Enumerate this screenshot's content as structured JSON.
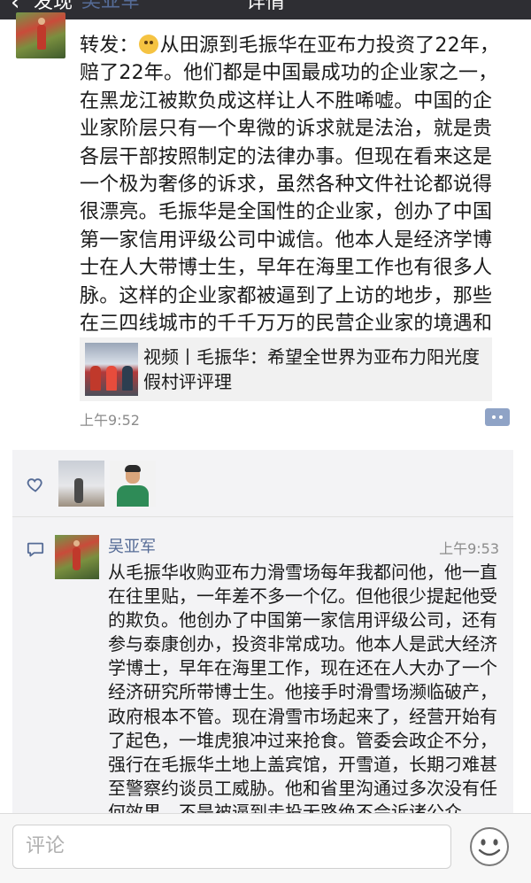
{
  "nav": {
    "back_label": "发现",
    "title": "详情"
  },
  "post": {
    "author": "吴亚军",
    "text_prefix": "转发：",
    "text": "从田源到毛振华在亚布力投资了22年，赔了22年。他们都是中国最成功的企业家之一，在黑龙江被欺负成这样让人不胜唏嘘。中国的企业家阶层只有一个卑微的诉求就是法治，就是贵各层干部按照制定的法律办事。但现在看来这是一个极为奢侈的诉求，虽然各种文件社论都说得很漂亮。毛振华是全国性的企业家，创办了中国第一家信用评级公司中诚信。他本人是经济学博士在人大带博士生，早年在海里工作也有很多人脉。这样的企业家都被逼到了上访的地步，那些在三四线城市的千千万万的民营企业家的境遇和辛酸可见一斑。",
    "share_title": "视频丨毛振华：希望全世界为亚布力阳光度假村评评理",
    "time": "上午9:52"
  },
  "comment": {
    "author": "吴亚军",
    "time": "上午9:53",
    "text": "从毛振华收购亚布力滑雪场每年我都问他，他一直在往里贴，一年差不多一个亿。但他很少提起他受的欺负。他创办了中国第一家信用评级公司，还有参与泰康创办，投资非常成功。他本人是武大经济学博士，早年在海里工作，现在还在人大办了一个经济研究所带博士生。他接手时滑雪场濒临破产，政府根本不管。现在滑雪市场起来了，经营开始有了起色，一堆虎狼冲过来抢食。管委会政企不分，强行在毛振华土地上盖宾馆，开雪道，长期刁难甚至警察约谈员工威胁。他和省里沟通过多次没有任何效果。不是被逼到走投无路绝不会诉诸公众"
  },
  "input": {
    "placeholder": "评论"
  },
  "icons": {
    "like": "heart-outline-icon",
    "comment": "comment-bubble-icon",
    "more": "more-dots-icon",
    "emoji": "smiley-face-icon",
    "back": "chevron-left-icon"
  },
  "colors": {
    "link_blue": "#556b96",
    "nav_bg": "#2e2e33",
    "panel_bg": "#f3f3f5",
    "time_gray": "#8c8c8c"
  }
}
